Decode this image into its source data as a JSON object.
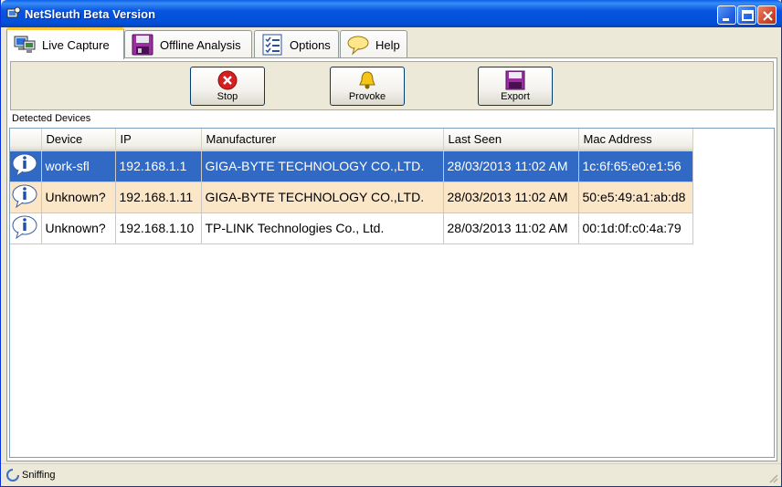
{
  "window": {
    "title": "NetSleuth Beta Version"
  },
  "tabs": [
    {
      "label": "Live Capture",
      "icon": "network-computer-icon",
      "active": true
    },
    {
      "label": "Offline Analysis",
      "icon": "floppy-disk-icon",
      "active": false
    },
    {
      "label": "Options",
      "icon": "checklist-icon",
      "active": false
    },
    {
      "label": "Help",
      "icon": "speech-bubble-icon",
      "active": false
    }
  ],
  "toolbar": {
    "stop_label": "Stop",
    "provoke_label": "Provoke",
    "export_label": "Export"
  },
  "devices": {
    "group_label": "Detected Devices",
    "columns": [
      "",
      "Device",
      "IP",
      "Manufacturer",
      "Last Seen",
      "Mac Address"
    ],
    "rows": [
      {
        "device": "work-sfl",
        "ip": "192.168.1.1",
        "manufacturer": "GIGA-BYTE TECHNOLOGY CO.,LTD.",
        "last_seen": "28/03/2013 11:02 AM",
        "mac": "1c:6f:65:e0:e1:56",
        "state": "selected"
      },
      {
        "device": "Unknown?",
        "ip": "192.168.1.11",
        "manufacturer": "GIGA-BYTE TECHNOLOGY CO.,LTD.",
        "last_seen": "28/03/2013 11:02 AM",
        "mac": "50:e5:49:a1:ab:d8",
        "state": "highlight"
      },
      {
        "device": "Unknown?",
        "ip": "192.168.1.10",
        "manufacturer": "TP-LINK Technologies Co., Ltd.",
        "last_seen": "28/03/2013 11:02 AM",
        "mac": "00:1d:0f:c0:4a:79",
        "state": "normal"
      }
    ]
  },
  "status": {
    "text": "Sniffing"
  },
  "colors": {
    "selection": "#316ac5",
    "highlight_row": "#fce6c8",
    "titlebar": "#0654e0"
  }
}
